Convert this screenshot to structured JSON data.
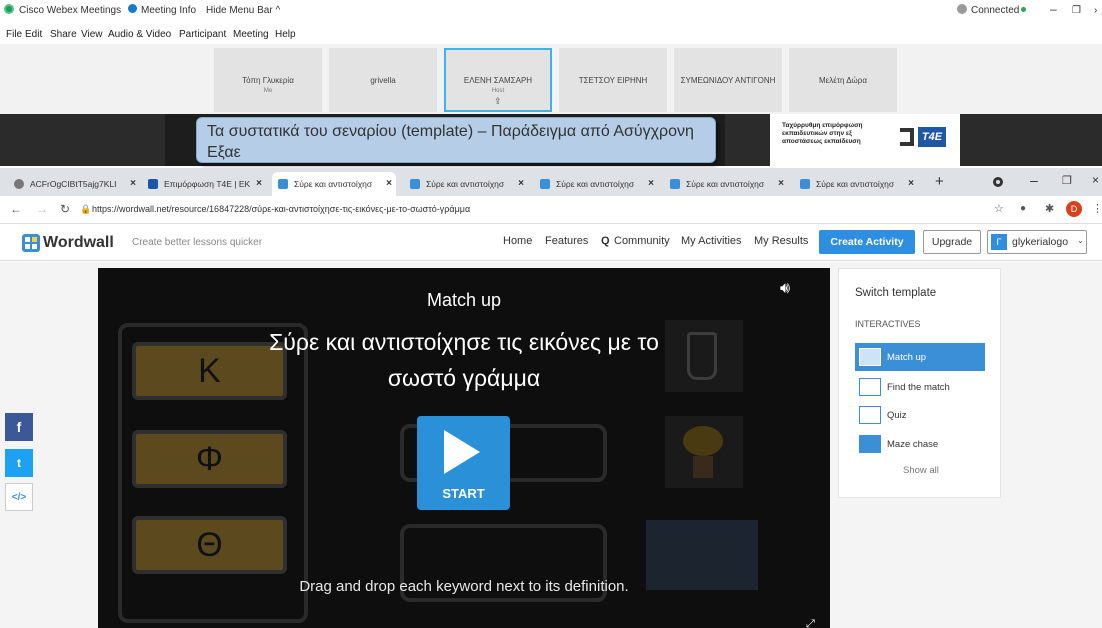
{
  "webex": {
    "app_title": "Cisco Webex Meetings",
    "meeting_info": "Meeting Info",
    "hide_menu": "Hide Menu Bar ^",
    "status": "Connected",
    "menu": [
      "File",
      "Edit",
      "Share",
      "View",
      "Audio & Video",
      "Participant",
      "Meeting",
      "Help"
    ],
    "participants": [
      {
        "name": "Τόπη Γλυκερία",
        "sub": "Me"
      },
      {
        "name": "grivella",
        "sub": ""
      },
      {
        "name": "ΕΛΕΝΗ ΣΑΜΣΑΡΗ",
        "sub": "Host"
      },
      {
        "name": "ΤΣΕΤΣΟΥ ΕΙΡΗΝΗ",
        "sub": ""
      },
      {
        "name": "ΣΥΜΕΩΝΙΔΟΥ ΑΝΤΙΓΟΝΗ",
        "sub": ""
      },
      {
        "name": "Μελέτη Δώρα",
        "sub": ""
      }
    ],
    "slide_title": "Τα συστατικά του σεναρίου (template) – Παράδειγμα από Ασύγχρονη Εξαε",
    "logo_text": "Ταχύρρυθμη επιμόρφωση εκπαιδευτικών στην εξ αποστάσεως εκπαίδευση",
    "logo_mark": "T4E"
  },
  "browser": {
    "tabs": [
      "ACFrOgCIBtT5ajg7KLI",
      "Επιμόρφωση T4E | EK",
      "Σύρε και αντιστοίχησ",
      "Σύρε και αντιστοίχησ",
      "Σύρε και αντιστοίχησ",
      "Σύρε και αντιστοίχησ",
      "Σύρε και αντιστοίχησ"
    ],
    "url": "https://wordwall.net/resource/16847228/σύρε-και-αντιστοίχησε-τις-εικόνες-με-το-σωστό-γράμμα",
    "avatar": "D"
  },
  "wordwall": {
    "brand": "Wordwall",
    "tagline": "Create better lessons quicker",
    "nav": {
      "home": "Home",
      "features": "Features",
      "community": "Community",
      "activities": "My Activities",
      "results": "My Results"
    },
    "create": "Create Activity",
    "upgrade": "Upgrade",
    "user": "glykerialogo",
    "user_initial": "Γ"
  },
  "game": {
    "template": "Match up",
    "title": "Σύρε και αντιστοίχησε τις εικόνες με το σωστό γράμμα",
    "start": "START",
    "instruction": "Drag and drop each keyword next to its definition.",
    "letters": [
      "Κ",
      "Φ",
      "Θ"
    ]
  },
  "sidebar": {
    "heading": "Switch template",
    "section": "INTERACTIVES",
    "items": [
      "Match up",
      "Find the match",
      "Quiz",
      "Maze chase"
    ],
    "show_all": "Show all"
  },
  "social": {
    "facebook": "f",
    "twitter": "t",
    "embed": "</>"
  }
}
